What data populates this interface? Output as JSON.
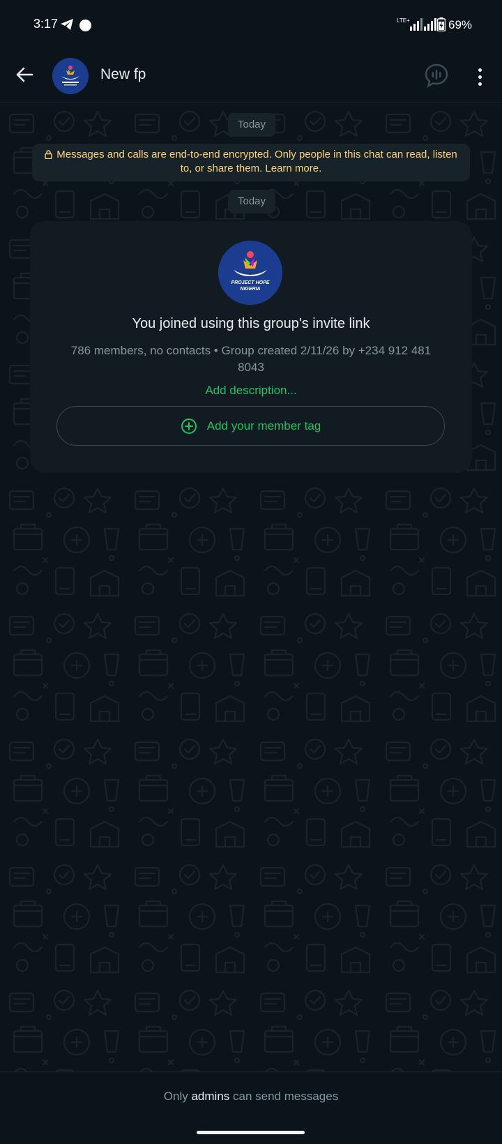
{
  "status_bar": {
    "time": "3:17",
    "network": "LTE+",
    "battery": "69%"
  },
  "header": {
    "title": "New fp",
    "avatar_text": "PROJECT HOPE NIGERIA"
  },
  "chat": {
    "date_chip_1": "Today",
    "encryption_notice": "Messages and calls are end-to-end encrypted. Only people in this chat can read, listen to, or share them. Learn more.",
    "date_chip_2": "Today"
  },
  "group_card": {
    "logo_line1": "PROJECT HOPE",
    "logo_line2": "NIGERIA",
    "title": "You joined using this group's invite link",
    "meta": "786 members, no contacts • Group created 2/11/26 by +234 912 481 8043",
    "add_description": "Add description...",
    "member_tag_label": "Add your member tag"
  },
  "footer": {
    "prefix": "Only",
    "admins": "admins",
    "suffix": "can send messages"
  },
  "colors": {
    "background": "#0b141a",
    "card": "#111b21",
    "accent_green": "#21c063",
    "notice_yellow": "#ffd279",
    "muted": "#8696a0",
    "logo_blue": "#1c3d8f"
  }
}
